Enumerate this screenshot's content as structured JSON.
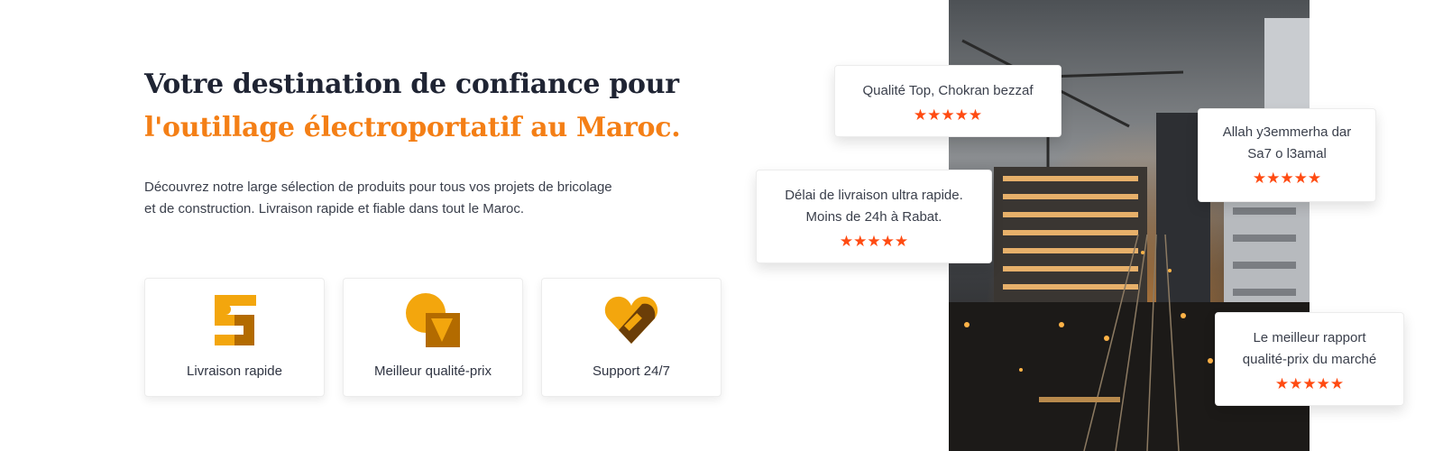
{
  "hero": {
    "headline_line1": "Votre destination de confiance pour",
    "headline_line2": "l'outillage électroportatif au Maroc.",
    "description": "Découvrez notre large sélection de produits pour tous vos projets de bricolage et de construction. Livraison rapide et fiable dans tout le Maroc."
  },
  "features": [
    {
      "label": "Livraison rapide",
      "icon": "s-logo-icon"
    },
    {
      "label": "Meilleur qualité-prix",
      "icon": "quality-badge-icon"
    },
    {
      "label": "Support 24/7",
      "icon": "heart-support-icon"
    }
  ],
  "colors": {
    "accent": "#f47f16",
    "stars": "#ff4b12",
    "icon_dark": "#b36b00",
    "icon_light": "#f3a60d"
  },
  "reviews": [
    {
      "text": "Qualité Top, Chokran bezzaf",
      "stars": "★★★★★",
      "rating": 5
    },
    {
      "text_line1": "Allah y3emmerha dar",
      "text_line2": "Sa7 o l3amal",
      "stars": "★★★★★",
      "rating": 5
    },
    {
      "text_line1": "Délai de livraison ultra rapide.",
      "text_line2": "Moins de 24h à Rabat.",
      "stars": "★★★★★",
      "rating": 5
    },
    {
      "text_line1": "Le meilleur rapport",
      "text_line2": "qualité-prix du marché",
      "stars": "★★★★★",
      "rating": 5
    }
  ]
}
